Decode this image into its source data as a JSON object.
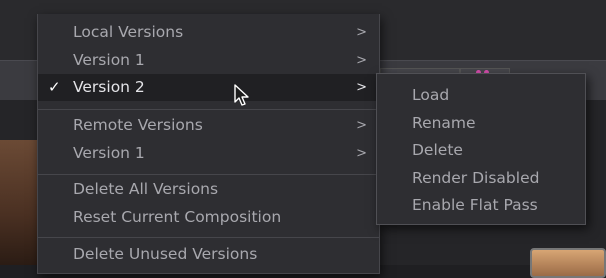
{
  "menu": {
    "items": [
      {
        "label": "Local Versions",
        "has_submenu": true
      },
      {
        "label": "Version 1",
        "has_submenu": true
      },
      {
        "label": "Version 2",
        "has_submenu": true,
        "checked": true,
        "highlighted": true
      },
      {
        "label": "Remote Versions",
        "has_submenu": true
      },
      {
        "label": "Version 1",
        "has_submenu": true
      },
      {
        "label": "Delete All Versions",
        "has_submenu": false
      },
      {
        "label": "Reset Current Composition",
        "has_submenu": false
      },
      {
        "label": "Delete Unused Versions",
        "has_submenu": false
      }
    ],
    "checkmark": "✓",
    "submenu_arrow": ">"
  },
  "submenu": {
    "items": [
      {
        "label": "Load"
      },
      {
        "label": "Rename"
      },
      {
        "label": "Delete"
      },
      {
        "label": "Render Disabled"
      },
      {
        "label": "Enable Flat Pass"
      }
    ]
  },
  "colors": {
    "menu_bg": "#2e2e32",
    "highlight_bg": "#202023",
    "text": "#a8a8ae",
    "text_active": "#e4e4e8"
  }
}
